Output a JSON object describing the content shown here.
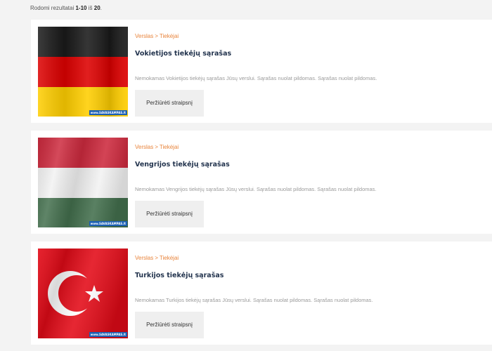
{
  "results": {
    "prefix": "Rodomi rezultatai",
    "range": "1-10",
    "of": "iš",
    "total": "20"
  },
  "articles": [
    {
      "category_parent": "Verslas",
      "category_sep": ">",
      "category": "Tiekėjai",
      "title": "Vokietijos tiekėjų sąrašas",
      "excerpt": "Nemokamas Vokietijos tiekėjų sąrašas Jūsų verslui. Sąrašas nuolat pildomas. Sąrašas nuolat pildomas.",
      "button": "Peržiūrėti straipsnį",
      "watermark": "www.SAVASKAMPAS.lt",
      "flag": "germany",
      "flag_colors": [
        "#000000",
        "#dd0000",
        "#ffce00"
      ]
    },
    {
      "category_parent": "Verslas",
      "category_sep": ">",
      "category": "Tiekėjai",
      "title": "Vengrijos tiekėjų sąrašas",
      "excerpt": "Nemokamas Vengrijos tiekėjų sąrašas Jūsų verslui. Sąrašas nuolat pildomas. Sąrašas nuolat pildomas.",
      "button": "Peržiūrėti straipsnį",
      "watermark": "www.SAVASKAMPAS.lt",
      "flag": "hungary",
      "flag_colors": [
        "#cd2a3e",
        "#ffffff",
        "#436f4d"
      ]
    },
    {
      "category_parent": "Verslas",
      "category_sep": ">",
      "category": "Tiekėjai",
      "title": "Turkijos tiekėjų sąrašas",
      "excerpt": "Nemokamas Turkijos tiekėjų sąrašas Jūsų verslui. Sąrašas nuolat pildomas. Sąrašas nuolat pildomas.",
      "button": "Peržiūrėti straipsnį",
      "watermark": "www.SAVASKAMPAS.lt",
      "flag": "turkey",
      "flag_colors": [
        "#e30a17",
        "#ffffff"
      ]
    }
  ],
  "colors": {
    "accent": "#e8833a",
    "title": "#23344e",
    "excerpt": "#9a9a9a",
    "page_bg": "#f3f3f3"
  }
}
